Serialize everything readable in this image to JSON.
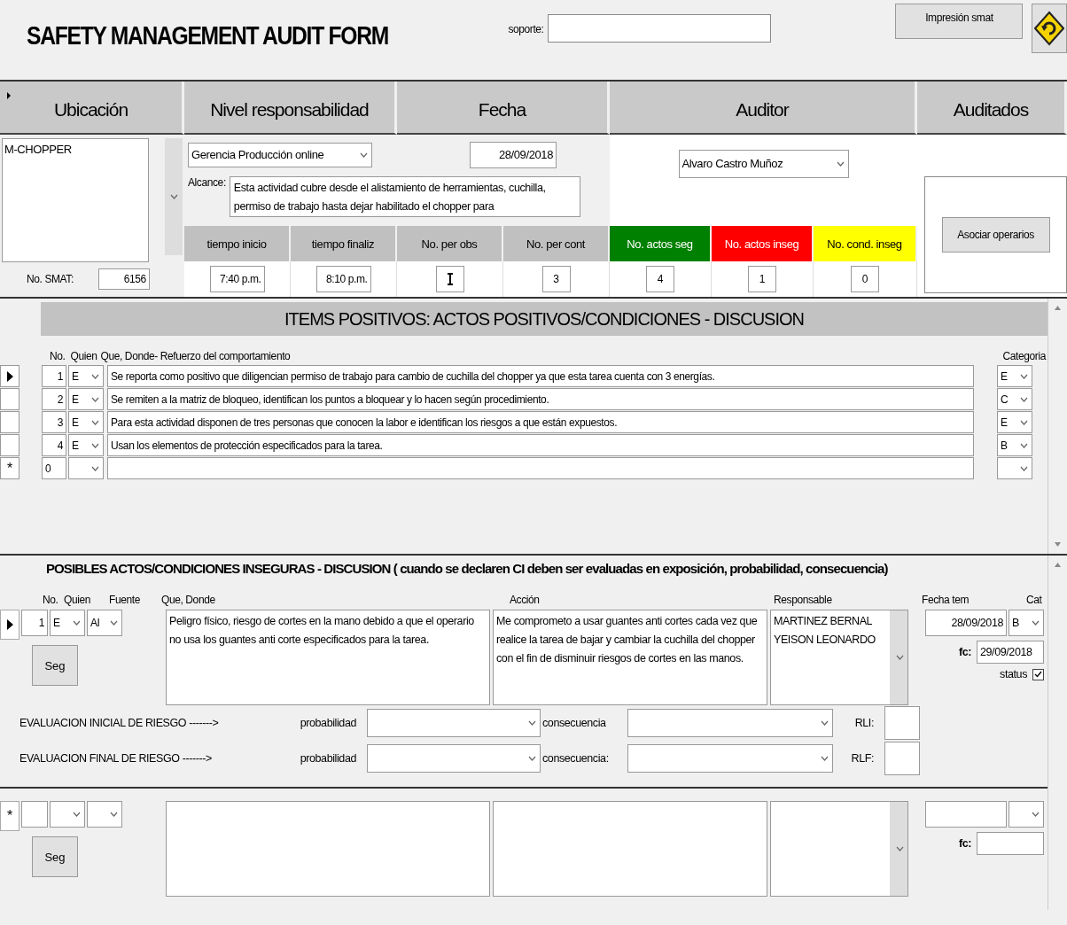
{
  "title": "SAFETY MANAGEMENT AUDIT FORM",
  "soporte": {
    "label": "soporte:"
  },
  "print_button": "Impresión smat",
  "headers": [
    "Ubicación",
    "Nivel responsabilidad",
    "Fecha",
    "Auditor",
    "Auditados"
  ],
  "ubicacion": "M-CHOPPER",
  "smat": {
    "label": "No. SMAT:",
    "value": "6156"
  },
  "nivel": "Gerencia Producción online",
  "fecha": "28/09/2018",
  "alcance": {
    "label": "Alcance:",
    "value": "Esta actividad cubre desde el alistamiento de herramientas, cuchilla, permiso de trabajo hasta dejar habilitado el chopper para"
  },
  "auditor": "Alvaro Castro Muñoz",
  "asociar_button": "Asociar operarios",
  "counts": [
    {
      "label": "tiempo inicio",
      "value": "7:40 p.m.",
      "color": "#c0c0c0"
    },
    {
      "label": "tiempo finaliz",
      "value": "8:10 p.m.",
      "color": "#c0c0c0"
    },
    {
      "label": "No. per obs",
      "color": "#c0c0c0"
    },
    {
      "label": "No. per cont",
      "value": "3",
      "color": "#c0c0c0"
    },
    {
      "label": "No. actos seg",
      "value": "4",
      "color": "#008000"
    },
    {
      "label": "No. actos inseg",
      "value": "1",
      "color": "#ff0000"
    },
    {
      "label": "No. cond. inseg",
      "value": "0",
      "color": "#ffff00"
    }
  ],
  "positivos": {
    "title": "ITEMS POSITIVOS: ACTOS POSITIVOS/CONDICIONES - DISCUSION",
    "columns": [
      "No.",
      "Quien",
      "Que, Donde- Refuerzo del comportamiento",
      "Categoria"
    ],
    "rows": [
      {
        "kind": "record",
        "selected": true,
        "no": "1",
        "quien": "E",
        "text": "Se reporta como positivo que diligencian permiso de trabajo para cambio de cuchilla del chopper ya que esta tarea cuenta con 3 energías.",
        "cat": "E"
      },
      {
        "kind": "record",
        "selected": false,
        "no": "2",
        "quien": "E",
        "text": "Se remiten a la matriz de bloqueo, identifican los puntos a bloquear y lo hacen según procedimiento.",
        "cat": "C"
      },
      {
        "kind": "record",
        "selected": false,
        "no": "3",
        "quien": "E",
        "text": "Para esta actividad disponen de tres personas que conocen la labor e identifican los riesgos a que están expuestos.",
        "cat": "E"
      },
      {
        "kind": "record",
        "selected": false,
        "no": "4",
        "quien": "E",
        "text": "Usan los elementos de protección especificados para la tarea.",
        "cat": "B"
      },
      {
        "kind": "new",
        "selected": false,
        "no": "0",
        "marker": "*"
      }
    ]
  },
  "inseguras": {
    "title": "POSIBLES ACTOS/CONDICIONES  INSEGURAS - DISCUSION ( cuando se declaren CI deben ser evaluadas en exposición, probabilidad, consecuencia)",
    "columns": [
      "No.",
      "Quien",
      "Fuente",
      "Que, Donde",
      "Acción",
      "Responsable",
      "Fecha tem",
      "Cat"
    ],
    "rows": [
      {
        "kind": "record",
        "selected": true,
        "no": "1",
        "quien": "E",
        "fuente": "AI",
        "que": "Peligro físico, riesgo de cortes en la mano debido a que el operario no usa los guantes anti corte especificados para la tarea.",
        "accion": "Me comprometo a usar guantes anti cortes cada vez que realice la tarea de bajar y cambiar la cuchilla del chopper con el fin de disminuir riesgos de cortes en las manos.",
        "responsable": "MARTINEZ BERNAL YEISON LEONARDO",
        "fecha": "28/09/2018",
        "cat": "B",
        "fc_label": "fc:",
        "fc": "29/09/2018",
        "seg": "Seg",
        "status_label": "status",
        "status_checked": true,
        "eval": [
          {
            "label": "EVALUACION INICIAL DE RIESGO ------->",
            "prob": "probabilidad",
            "cons": "consecuencia",
            "r": "RLI:"
          },
          {
            "label": "EVALUACION FINAL DE RIESGO ------->",
            "prob": "probabilidad",
            "cons": "consecuencia:",
            "r": "RLF:"
          }
        ]
      },
      {
        "kind": "new",
        "selected": false,
        "marker": "*",
        "fc_label": "fc:",
        "seg": "Seg"
      }
    ]
  }
}
